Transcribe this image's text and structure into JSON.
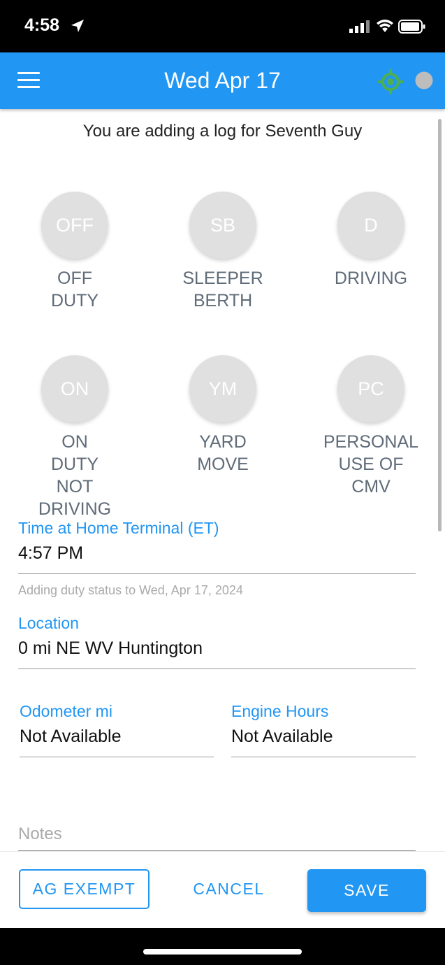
{
  "status_bar": {
    "time": "4:58"
  },
  "header": {
    "title": "Wed Apr 17",
    "gps_status_color": "#4caf50",
    "connection_dot_color": "#bdbdbd"
  },
  "notice": "You are adding a log for Seventh Guy",
  "statuses": [
    {
      "code": "OFF",
      "label": "OFF\nDUTY"
    },
    {
      "code": "SB",
      "label": "SLEEPER\nBERTH"
    },
    {
      "code": "D",
      "label": "DRIVING"
    },
    {
      "code": "ON",
      "label": "ON\nDUTY\nNOT\nDRIVING"
    },
    {
      "code": "YM",
      "label": "YARD\nMOVE"
    },
    {
      "code": "PC",
      "label": "PERSONAL\nUSE OF\nCMV"
    }
  ],
  "time_field": {
    "label": "Time at Home Terminal (ET)",
    "value": "4:57 PM"
  },
  "hint": "Adding duty status to Wed, Apr 17, 2024",
  "location": {
    "label": "Location",
    "value": "0 mi NE WV Huntington"
  },
  "odometer": {
    "label": "Odometer mi",
    "value": "Not Available"
  },
  "engine_hours": {
    "label": "Engine Hours",
    "value": "Not Available"
  },
  "notes": {
    "placeholder": "Notes"
  },
  "buttons": {
    "ag_exempt": "AG EXEMPT",
    "cancel": "CANCEL",
    "save": "SAVE"
  },
  "colors": {
    "primary": "#2196f3",
    "inactive_circle": "#e0e0e0",
    "label_gray": "#5f6b78"
  }
}
